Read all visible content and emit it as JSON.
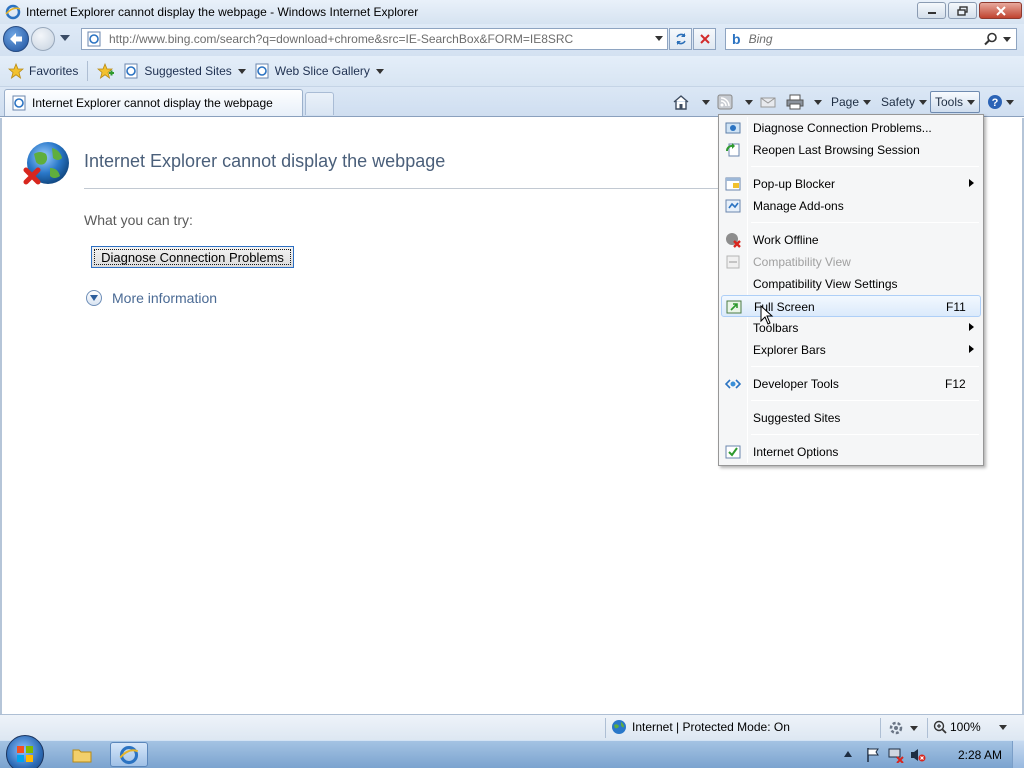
{
  "window": {
    "title": "Internet Explorer cannot display the webpage - Windows Internet Explorer"
  },
  "navigation": {
    "address": "http://www.bing.com/search?q=download+chrome&src=IE-SearchBox&FORM=IE8SRC",
    "search_placeholder": "Bing"
  },
  "favorites_bar": {
    "favorites_label": "Favorites",
    "suggested_sites_label": "Suggested Sites",
    "web_slice_label": "Web Slice Gallery"
  },
  "tab": {
    "label": "Internet Explorer cannot display the webpage"
  },
  "command_bar": {
    "page_label": "Page",
    "safety_label": "Safety",
    "tools_label": "Tools"
  },
  "page": {
    "heading": "Internet Explorer cannot display the webpage",
    "try_label": "What you can try:",
    "diagnose_button": "Diagnose Connection Problems",
    "more_info_label": "More information"
  },
  "tools_menu": {
    "items": [
      {
        "label": "Diagnose Connection Problems...",
        "shortcut": "",
        "icon": "diagnose-icon"
      },
      {
        "label": "Reopen Last Browsing Session",
        "shortcut": "",
        "icon": "reopen-icon"
      },
      {
        "label": "Pop-up Blocker",
        "shortcut": "",
        "icon": "popup-blocker-icon"
      },
      {
        "label": "Manage Add-ons",
        "shortcut": "",
        "icon": "addons-icon"
      },
      {
        "label": "Work Offline",
        "shortcut": "",
        "icon": "work-offline-icon"
      },
      {
        "label": "Compatibility View",
        "shortcut": "",
        "icon": "compat-view-icon"
      },
      {
        "label": "Compatibility View Settings",
        "shortcut": "",
        "icon": ""
      },
      {
        "label": "Full Screen",
        "shortcut": "F11",
        "icon": "fullscreen-icon"
      },
      {
        "label": "Toolbars",
        "shortcut": "",
        "icon": ""
      },
      {
        "label": "Explorer Bars",
        "shortcut": "",
        "icon": ""
      },
      {
        "label": "Developer Tools",
        "shortcut": "F12",
        "icon": "dev-tools-icon"
      },
      {
        "label": "Suggested Sites",
        "shortcut": "",
        "icon": ""
      },
      {
        "label": "Internet Options",
        "shortcut": "",
        "icon": "internet-options-icon"
      }
    ]
  },
  "status_bar": {
    "zone": "Internet | Protected Mode: On",
    "zoom": "100%"
  },
  "taskbar": {
    "clock": "2:28 AM"
  },
  "colors": {
    "accent": "#2b73c2",
    "chrome_bg": "#d8e5f3",
    "menu_highlight": "#dbeafb"
  }
}
